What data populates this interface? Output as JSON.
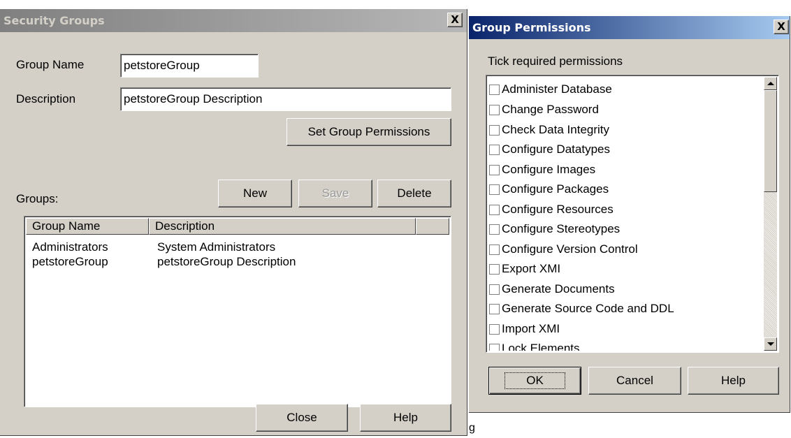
{
  "security_groups": {
    "title": "Security Groups",
    "close_glyph": "X",
    "group_name_label": "Group Name",
    "group_name_value": "petstoreGroup",
    "description_label": "Description",
    "description_value": "petstoreGroup Description",
    "set_permissions_label": "Set Group Permissions",
    "groups_label": "Groups:",
    "new_label": "New",
    "save_label": "Save",
    "delete_label": "Delete",
    "columns": [
      "Group Name",
      "Description"
    ],
    "rows": [
      [
        "Administrators",
        "System Administrators"
      ],
      [
        "petstoreGroup",
        "petstoreGroup Description"
      ]
    ],
    "close_label": "Close",
    "help_label": "Help"
  },
  "group_permissions": {
    "title": "Group Permissions",
    "close_glyph": "X",
    "instruction": "Tick required permissions",
    "permissions": [
      "Administer Database",
      "Change Password",
      "Check Data Integrity",
      "Configure Datatypes",
      "Configure Images",
      "Configure Packages",
      "Configure Resources",
      "Configure Stereotypes",
      "Configure Version Control",
      "Export XMI",
      "Generate Documents",
      "Generate Source Code and DDL",
      "Import XMI",
      "Lock Elements"
    ],
    "ok_label": "OK",
    "cancel_label": "Cancel",
    "help_label": "Help"
  },
  "stray_text": "g",
  "colors": {
    "dialog_face": "#d4d0c8",
    "active_title_start": "#0a246a",
    "active_title_end": "#a6caf0",
    "inactive_title_start": "#808080",
    "inactive_title_end": "#b7b7b7"
  },
  "icons": {
    "close": "close-icon",
    "scroll_up": "scroll-up-arrow-icon",
    "scroll_down": "scroll-down-arrow-icon"
  }
}
